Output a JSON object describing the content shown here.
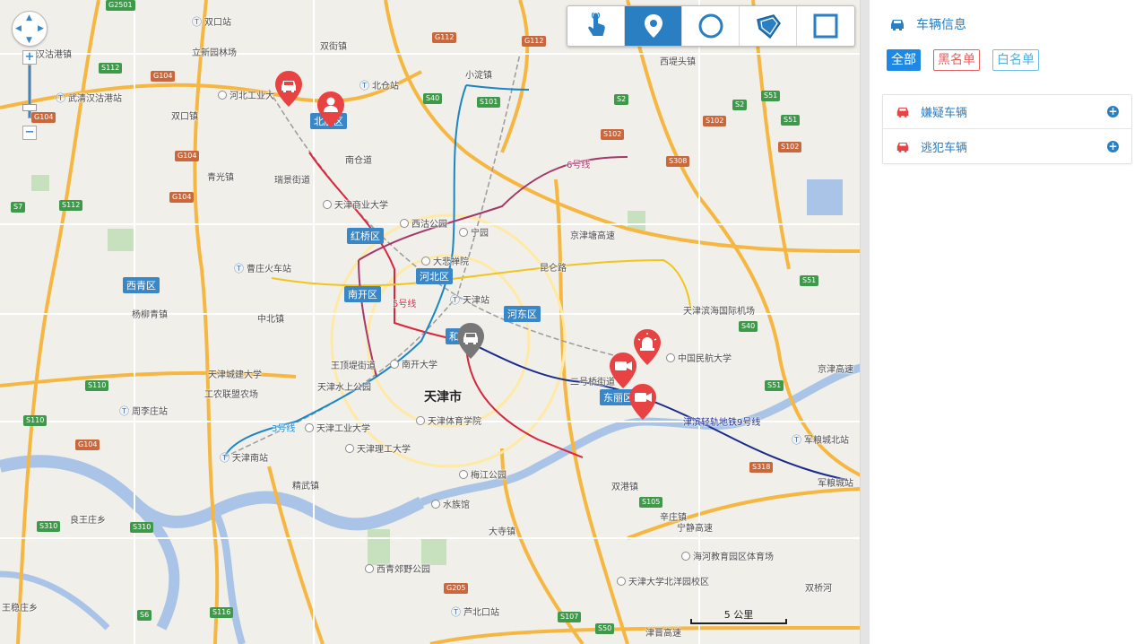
{
  "map": {
    "city_label": "天津市",
    "district_labels": [
      "北辰区",
      "红桥区",
      "河北区",
      "南开区",
      "河东区",
      "西青区",
      "和平区",
      "东丽区"
    ],
    "place_labels": [
      "双口站",
      "汉沽港镇",
      "立新园林场",
      "双街镇",
      "小淀镇",
      "西堤头镇",
      "武清汉沽港站",
      "河北工业大",
      "北仓站",
      "双口镇",
      "南仓道",
      "瑞景街道",
      "天津商业大学",
      "青光镇",
      "西沽公园",
      "宁园",
      "大悲禅院",
      "曹庄火车站",
      "天津站",
      "杨柳青镇",
      "中北镇",
      "天津滨海国际机场",
      "中国民航大学",
      "王顶堤街道",
      "南开大学",
      "天津城建大学",
      "天津水上公园",
      "工农联盟农场",
      "二号桥街道",
      "周李庄站",
      "天津工业大学",
      "天津体育学院",
      "军粮城北站",
      "天津理工大学",
      "天津南站",
      "梅江公园",
      "精武镇",
      "水族馆",
      "双港镇",
      "军粮城站",
      "良王庄乡",
      "辛庄镇",
      "大寺镇",
      "海河教育园区体育场",
      "西青郊野公园",
      "天津大学北洋园校区",
      "双桥河",
      "王稳庄乡",
      "芦北口站",
      "津晋高速",
      "宁静高速",
      "京津塘高速",
      "京津高速",
      "津滨轻轨地铁9号线",
      "5号线",
      "6号线",
      "3号线",
      "昆仑路"
    ],
    "road_shields": [
      "G2501",
      "G112",
      "G112",
      "S112",
      "G104",
      "G104",
      "G104",
      "G104",
      "S7",
      "S112",
      "S40",
      "S101",
      "S2",
      "S2",
      "S51",
      "S51",
      "S102",
      "S102",
      "S102",
      "S308",
      "S51",
      "S40",
      "S51",
      "S110",
      "S110",
      "S318",
      "S105",
      "S310",
      "S310",
      "G205",
      "S6",
      "S116",
      "S107",
      "S50"
    ],
    "scale_label": "5 公里",
    "nav_labels": {
      "zoom_in": "+",
      "zoom_out": "−",
      "zoom_out_2": "−"
    },
    "markers": [
      {
        "type": "vehicle",
        "color": "#e84242"
      },
      {
        "type": "person",
        "color": "#e84242"
      },
      {
        "type": "vehicle",
        "color": "#777777"
      },
      {
        "type": "alarm",
        "color": "#e84242"
      },
      {
        "type": "camera",
        "color": "#e84242"
      },
      {
        "type": "camera",
        "color": "#e84242"
      }
    ],
    "toolbar": [
      {
        "icon": "pointer-hand-icon",
        "active": false
      },
      {
        "icon": "location-pin-icon",
        "active": true
      },
      {
        "icon": "circle-icon",
        "active": false
      },
      {
        "icon": "polygon-icon",
        "active": false
      },
      {
        "icon": "rectangle-icon",
        "active": false
      }
    ]
  },
  "panel": {
    "title": "车辆信息",
    "filters": {
      "all": "全部",
      "blacklist": "黑名单",
      "whitelist": "白名单"
    },
    "items": [
      {
        "label": "嫌疑车辆",
        "icon": "car-icon",
        "icon_color": "#e84242"
      },
      {
        "label": "逃犯车辆",
        "icon": "car-icon",
        "icon_color": "#e84242"
      }
    ]
  },
  "colors": {
    "accent": "#2a7ec2",
    "danger": "#e84242",
    "whitelist": "#4fb0df"
  }
}
